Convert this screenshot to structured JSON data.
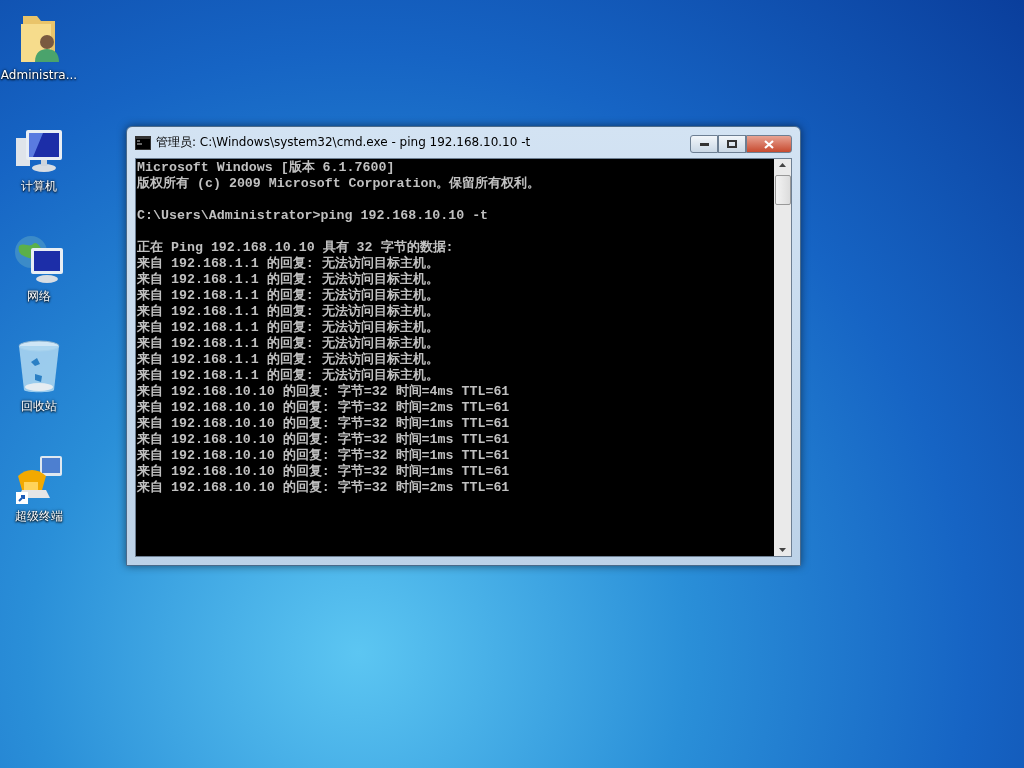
{
  "desktop_icons": [
    {
      "kind": "user-folder",
      "label": "Administra..."
    },
    {
      "kind": "computer",
      "label": "计算机"
    },
    {
      "kind": "network",
      "label": "网络"
    },
    {
      "kind": "recycle-bin",
      "label": "回收站"
    },
    {
      "kind": "shortcut-app",
      "label": "超级终端"
    }
  ],
  "window": {
    "title": "管理员: C:\\Windows\\system32\\cmd.exe - ping  192.168.10.10 -t",
    "console_blocks": [
      [
        "Microsoft Windows [版本 6.1.7600]",
        "版权所有 (c) 2009 Microsoft Corporation。保留所有权利。"
      ],
      [
        "C:\\Users\\Administrator>ping 192.168.10.10 -t"
      ],
      [
        "正在 Ping 192.168.10.10 具有 32 字节的数据:",
        "来自 192.168.1.1 的回复: 无法访问目标主机。",
        "来自 192.168.1.1 的回复: 无法访问目标主机。",
        "来自 192.168.1.1 的回复: 无法访问目标主机。",
        "来自 192.168.1.1 的回复: 无法访问目标主机。",
        "来自 192.168.1.1 的回复: 无法访问目标主机。",
        "来自 192.168.1.1 的回复: 无法访问目标主机。",
        "来自 192.168.1.1 的回复: 无法访问目标主机。",
        "来自 192.168.1.1 的回复: 无法访问目标主机。",
        "来自 192.168.10.10 的回复: 字节=32 时间=4ms TTL=61",
        "来自 192.168.10.10 的回复: 字节=32 时间=2ms TTL=61",
        "来自 192.168.10.10 的回复: 字节=32 时间=1ms TTL=61",
        "来自 192.168.10.10 的回复: 字节=32 时间=1ms TTL=61",
        "来自 192.168.10.10 的回复: 字节=32 时间=1ms TTL=61",
        "来自 192.168.10.10 的回复: 字节=32 时间=1ms TTL=61",
        "来自 192.168.10.10 的回复: 字节=32 时间=2ms TTL=61"
      ]
    ]
  }
}
